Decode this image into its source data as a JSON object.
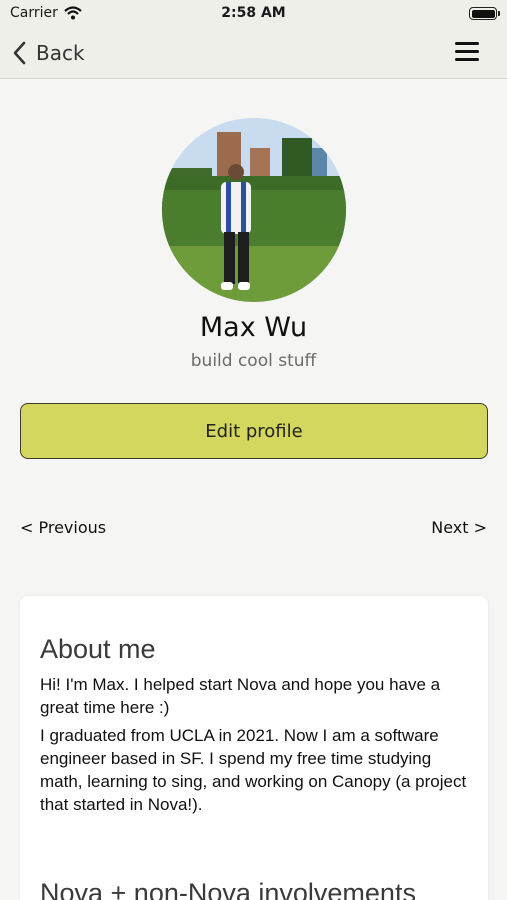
{
  "status_bar": {
    "carrier": "Carrier",
    "time": "2:58 AM"
  },
  "nav": {
    "back_label": "Back"
  },
  "profile": {
    "name": "Max Wu",
    "tagline": "build cool stuff",
    "edit_label": "Edit profile"
  },
  "pager": {
    "previous_label": "< Previous",
    "next_label": "Next >"
  },
  "about": {
    "title": "About me",
    "paragraphs": [
      "Hi! I'm Max. I helped start Nova and hope you have a great time here :)",
      "I graduated from UCLA in 2021. Now I am a software engineer based in SF. I spend my free time studying math, learning to sing, and working on Canopy (a project that started in Nova!)."
    ],
    "next_section_title": "Nova + non-Nova involvements"
  }
}
